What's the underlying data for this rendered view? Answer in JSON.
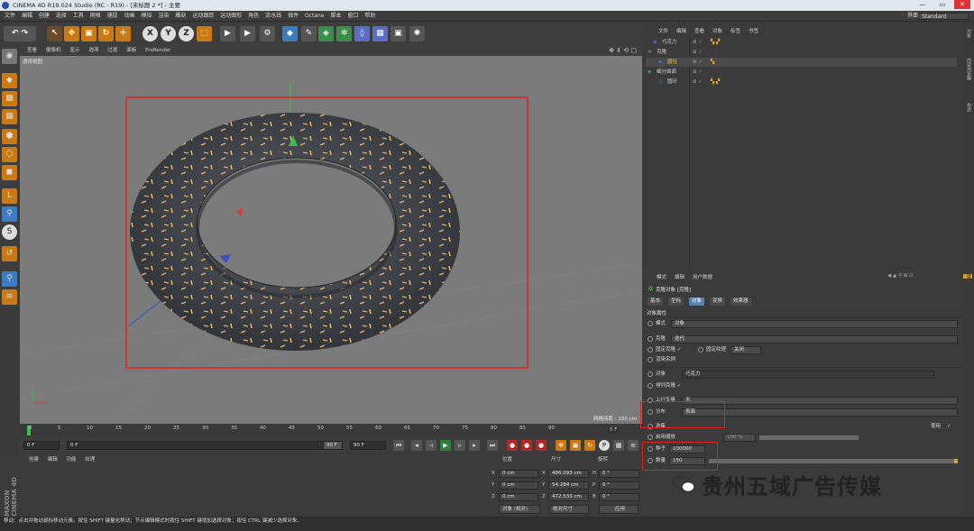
{
  "window": {
    "title": "CINEMA 4D R19.024 Studio (RC - R19) - [未标题 2 *] - 主要",
    "minimize": "—",
    "maximize": "▭",
    "close": "✕"
  },
  "menubar": {
    "items": [
      "文件",
      "编辑",
      "创建",
      "选择",
      "工具",
      "网格",
      "捕捉",
      "动画",
      "模拟",
      "渲染",
      "雕刻",
      "运动跟踪",
      "运动图形",
      "角色",
      "流水线",
      "插件",
      "Octane",
      "脚本",
      "窗口",
      "帮助"
    ],
    "layout_label": "界面",
    "layout_value": "Standard"
  },
  "viewport": {
    "menu": [
      "查看",
      "摄像机",
      "显示",
      "选项",
      "过滤",
      "面板",
      "ProRender"
    ],
    "label": "透视视图",
    "grid_spacing": "网格间距 : 100 cm"
  },
  "timeline": {
    "ticks": [
      "0",
      "5",
      "10",
      "15",
      "20",
      "25",
      "30",
      "35",
      "40",
      "45",
      "50",
      "55",
      "60",
      "65",
      "70",
      "75",
      "80",
      "85",
      "90"
    ],
    "end_label": "0 F"
  },
  "transport": {
    "start": "0 F",
    "current": "0 F",
    "range_end": "90 F",
    "end": "90 F"
  },
  "material": {
    "menu": [
      "创建",
      "编辑",
      "功能",
      "纹理"
    ]
  },
  "coords": {
    "headers": [
      "位置",
      "尺寸",
      "旋转"
    ],
    "rows": [
      {
        "axis": "X",
        "pos": "0 cm",
        "size_axis": "X",
        "size": "486.093 cm",
        "rot_axis": "H",
        "rot": "0 °"
      },
      {
        "axis": "Y",
        "pos": "0 cm",
        "size_axis": "Y",
        "size": "54.284 cm",
        "rot_axis": "P",
        "rot": "0 °"
      },
      {
        "axis": "Z",
        "pos": "0 cm",
        "size_axis": "Z",
        "size": "472.533 cm",
        "rot_axis": "B",
        "rot": "0 °"
      }
    ],
    "mode": "对象 (相对)",
    "size_mode": "绝对尺寸",
    "apply": "应用"
  },
  "status": "移动：点击并拖动鼠标移动元素。按住 SHIFT 键量化移动；节点编辑模式时按住 SHIFT 键增加选择对象；按住 CTRL 键减少选择对象。",
  "objmgr": {
    "menu": [
      "文件",
      "编辑",
      "查看",
      "对象",
      "标签",
      "书签"
    ],
    "objects": [
      {
        "name": "巧克力",
        "indent": 0
      },
      {
        "name": "克隆",
        "indent": 0
      },
      {
        "name": "圆柱",
        "indent": 1
      },
      {
        "name": "细分曲面",
        "indent": 0
      },
      {
        "name": "圆环",
        "indent": 1
      }
    ]
  },
  "attrmgr": {
    "menu": [
      "模式",
      "编辑",
      "用户数据"
    ],
    "title": "克隆对象 [克隆]",
    "tabs": [
      "基本",
      "坐标",
      "对象",
      "变换",
      "效果器"
    ],
    "active_tab": 2,
    "section": "对象属性",
    "mode_label": "模式",
    "mode_value": "对象",
    "clones_label": "克隆",
    "clones_value": "迭代",
    "fix_clone_label": "固定克隆",
    "fix_texture_label": "固定纹理",
    "fix_texture_value": "关闭",
    "instance_label": "渲染实例",
    "object_label": "对象",
    "object_value": "巧克力",
    "align_label": "排列克隆",
    "up_vector_label": "上行矢量",
    "up_vector_value": "无",
    "distribution_label": "分布",
    "distribution_value": "表面",
    "selection_label": "选集",
    "use_label": "使用",
    "scale_label": "启用缩放",
    "scale_value": "100 %",
    "seed_label": "种子",
    "seed_value": "100000",
    "count_label": "数量",
    "count_value": "150"
  },
  "right_tabs": [
    "对象",
    "内容浏览器",
    "构造",
    "层"
  ],
  "watermark": "贵州五域广告传媒"
}
